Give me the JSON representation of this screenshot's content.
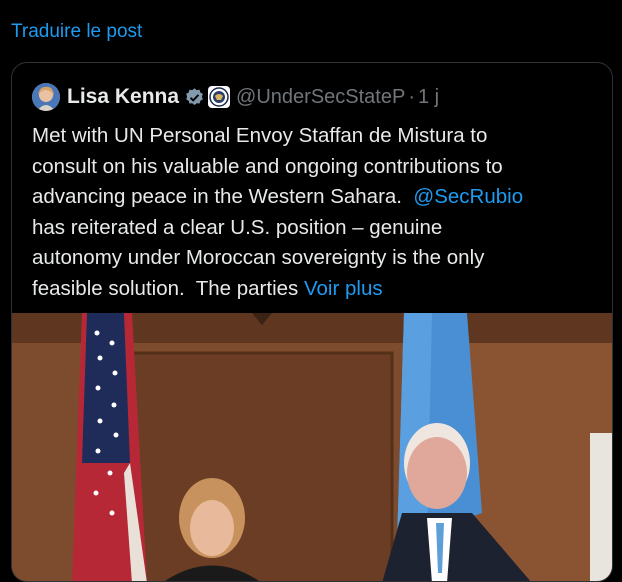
{
  "translate_link": "Traduire le post",
  "quoted_post": {
    "author_name": "Lisa Kenna",
    "handle": "@UnderSecStateP",
    "separator": "·",
    "time": "1 j",
    "lines": [
      {
        "pre": "Met with UN Personal Envoy Staffan de Mistura to"
      },
      {
        "pre": "consult on his valuable and ongoing contributions to"
      },
      {
        "pre": "advancing peace in the Western Sahara.  ",
        "mention": "@SecRubio"
      },
      {
        "pre": "has reiterated a clear U.S. position – genuine"
      },
      {
        "pre": "autonomy under Moroccan sovereignty is the only"
      },
      {
        "pre": "feasible solution.  The parties ",
        "more": "Voir plus"
      }
    ]
  },
  "colors": {
    "link": "#1d9bf0",
    "text": "#e7e9ea",
    "muted": "#71767b",
    "border": "#2f3336",
    "background": "#000000"
  },
  "icons": [
    "verified-badge-icon",
    "state-dept-seal-icon"
  ]
}
